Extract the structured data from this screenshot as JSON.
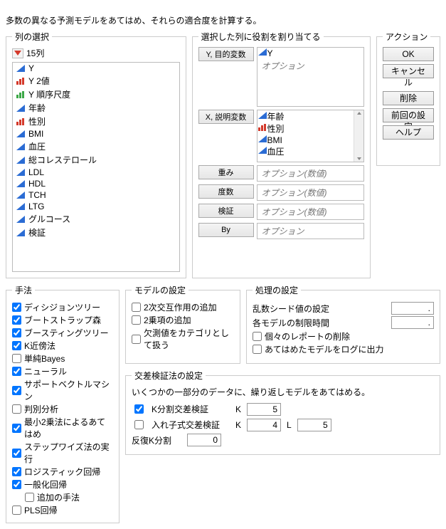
{
  "description": "多数の異なる予測モデルをあてはめ、それらの適合度を計算する。",
  "column_select": {
    "legend": "列の選択",
    "count_label": "15列",
    "items": [
      {
        "icon": "cont-blue",
        "label": "Y"
      },
      {
        "icon": "bar-red",
        "label": "Y 2値"
      },
      {
        "icon": "bar-green",
        "label": "Y 順序尺度"
      },
      {
        "icon": "cont-blue",
        "label": "年齢"
      },
      {
        "icon": "bar-red",
        "label": "性別"
      },
      {
        "icon": "cont-blue",
        "label": "BMI"
      },
      {
        "icon": "cont-blue",
        "label": "血圧"
      },
      {
        "icon": "cont-blue",
        "label": "総コレステロール"
      },
      {
        "icon": "cont-blue",
        "label": "LDL"
      },
      {
        "icon": "cont-blue",
        "label": "HDL"
      },
      {
        "icon": "cont-blue",
        "label": "TCH"
      },
      {
        "icon": "cont-blue",
        "label": "LTG"
      },
      {
        "icon": "cont-blue",
        "label": "グルコース"
      },
      {
        "icon": "cont-blue",
        "label": "検証"
      }
    ]
  },
  "roles": {
    "legend": "選択した列に役割を割り当てる",
    "y": {
      "button": "Y, 目的変数",
      "items": [
        {
          "icon": "cont-blue",
          "label": "Y"
        }
      ],
      "placeholder": "オプション"
    },
    "x": {
      "button": "X, 説明変数",
      "items": [
        {
          "icon": "cont-blue",
          "label": "年齢"
        },
        {
          "icon": "bar-red",
          "label": "性別"
        },
        {
          "icon": "cont-blue",
          "label": "BMI"
        },
        {
          "icon": "cont-blue",
          "label": "血圧"
        }
      ]
    },
    "weight": {
      "button": "重み",
      "placeholder": "オプション(数値)"
    },
    "freq": {
      "button": "度数",
      "placeholder": "オプション(数値)"
    },
    "valid": {
      "button": "検証",
      "placeholder": "オプション(数値)"
    },
    "by": {
      "button": "By",
      "placeholder": "オプション"
    }
  },
  "actions": {
    "legend": "アクション",
    "ok": "OK",
    "cancel": "キャンセル",
    "remove": "削除",
    "recall": "前回の設定",
    "help": "ヘルプ"
  },
  "methods": {
    "legend": "手法",
    "items": [
      {
        "label": "ディシジョンツリー",
        "checked": true
      },
      {
        "label": "ブートストラップ森",
        "checked": true
      },
      {
        "label": "ブースティングツリー",
        "checked": true
      },
      {
        "label": "K近傍法",
        "checked": true
      },
      {
        "label": "単純Bayes",
        "checked": false
      },
      {
        "label": "ニューラル",
        "checked": true
      },
      {
        "label": "サポートベクトルマシン",
        "checked": true
      },
      {
        "label": "判別分析",
        "checked": false
      },
      {
        "label": "最小2乗法によるあてはめ",
        "checked": true
      },
      {
        "label": "ステップワイズ法の実行",
        "checked": true
      },
      {
        "label": "ロジスティック回帰",
        "checked": true
      },
      {
        "label": "一般化回帰",
        "checked": true
      },
      {
        "label": "追加の手法",
        "checked": false,
        "indent": true
      },
      {
        "label": "PLS回帰",
        "checked": false
      }
    ]
  },
  "model_settings": {
    "legend": "モデルの設定",
    "items": [
      {
        "label": "2次交互作用の追加",
        "checked": false
      },
      {
        "label": "2乗項の追加",
        "checked": false
      },
      {
        "label": "欠測値をカテゴリとして扱う",
        "checked": false
      }
    ]
  },
  "proc_settings": {
    "legend": "処理の設定",
    "seed_label": "乱数シード値の設定",
    "seed_value": ".",
    "timelimit_label": "各モデルの制限時間",
    "timelimit_value": ".",
    "items": [
      {
        "label": "個々のレポートの削除",
        "checked": false
      },
      {
        "label": "あてはめたモデルをログに出力",
        "checked": false
      }
    ]
  },
  "cross_validation": {
    "legend": "交差検証法の設定",
    "desc": "いくつかの一部分のデータに、繰り返しモデルをあてはめる。",
    "kfold": {
      "label": "K分割交差検証",
      "checked": true,
      "k_label": "K",
      "k_value": "5"
    },
    "nested": {
      "label": "入れ子式交差検証",
      "checked": false,
      "k_label": "K",
      "k_value": "4",
      "l_label": "L",
      "l_value": "5"
    },
    "repeat": {
      "label": "反復K分割",
      "value": "0"
    }
  }
}
